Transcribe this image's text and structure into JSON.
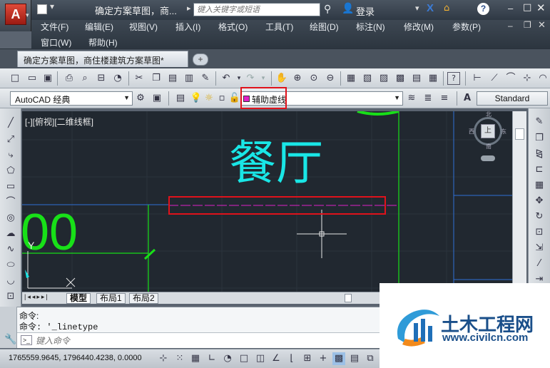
{
  "title": {
    "window_title": "确定方案草图，商...",
    "search_placeholder": "键入关键字或短语",
    "login": "登录",
    "help": "?"
  },
  "menu": {
    "row1": [
      "文件(F)",
      "编辑(E)",
      "视图(V)",
      "插入(I)",
      "格式(O)",
      "工具(T)",
      "绘图(D)",
      "标注(N)",
      "修改(M)",
      "参数(P)"
    ],
    "row2": [
      "窗口(W)",
      "帮助(H)"
    ]
  },
  "app": {
    "logo": "A"
  },
  "document_tab": {
    "label": "确定方案草图，商住楼建筑方案草图*"
  },
  "toolbar": {
    "workspace": "AutoCAD 经典",
    "layer": "辅助虚线",
    "text_style": "Standard"
  },
  "viewport": {
    "label": "[-][俯视][二维线框]",
    "room_label": "餐厅",
    "dimension_text": "00",
    "ucs_y": "Y",
    "viewcube_top": "上",
    "viewcube_north": "北",
    "viewcube_south": "南",
    "viewcube_west": "西",
    "viewcube_east": "东"
  },
  "layout_tabs": [
    "模型",
    "布局1",
    "布局2"
  ],
  "command": {
    "line1": "命令:",
    "line2": "命令: '_linetype",
    "input_placeholder": "键入命令"
  },
  "status": {
    "coordinates": "1765559.9645, 1796440.4238, 0.0000"
  },
  "watermark": {
    "title": "土木工程网",
    "url": "www.civilcn.com"
  },
  "colors": {
    "canvas_bg": "#212830",
    "room_text": "#19e6e6",
    "green_lines": "#18e018",
    "blue_lines": "#2f6fd6",
    "highlight_red": "#e0121b",
    "layer_swatch": "#e020c8"
  }
}
